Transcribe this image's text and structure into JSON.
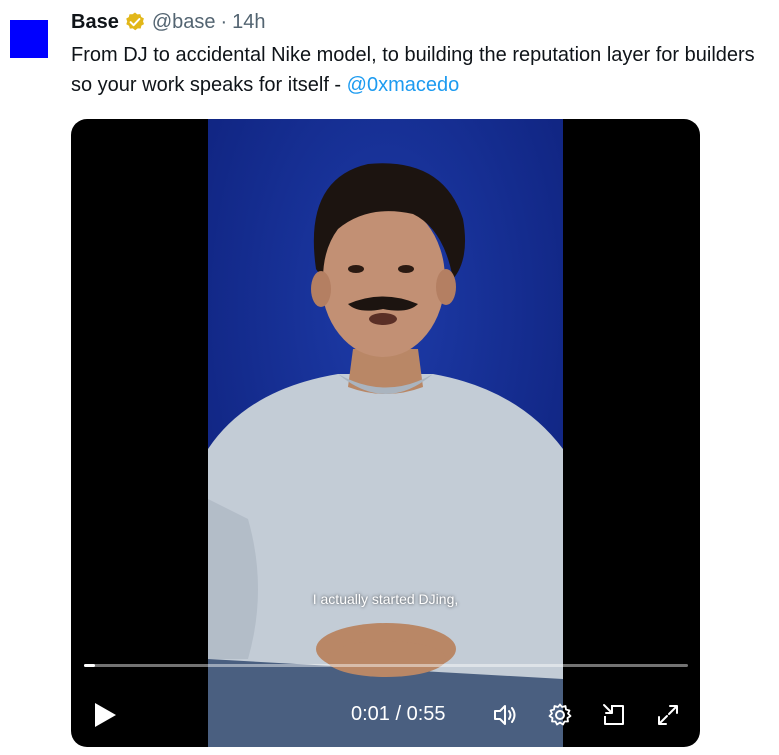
{
  "tweet": {
    "author_name": "Base",
    "handle": "@base",
    "separator": "·",
    "timestamp": "14h",
    "text": "From DJ to accidental Nike model, to building the reputation layer for builders so your work speaks for itself - ",
    "mention": "@0xmacedo",
    "avatar_color": "#0000ff",
    "badge_color": "#e2b719"
  },
  "video": {
    "subtitle": "I actually started DJing,",
    "current_time": "0:01",
    "time_separator": "/",
    "duration": "0:55",
    "progress_fraction": 0.018,
    "icons": {
      "play": "play-icon",
      "volume": "volume-icon",
      "settings": "gear-icon",
      "pip": "picture-in-picture-icon",
      "fullscreen": "fullscreen-icon"
    }
  }
}
